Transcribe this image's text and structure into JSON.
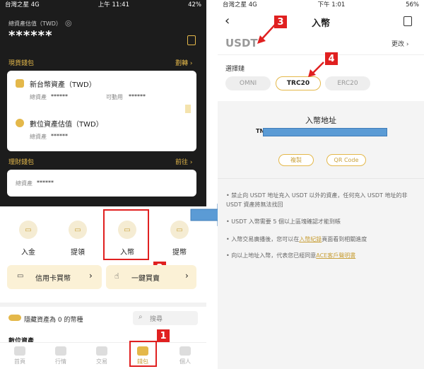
{
  "left": {
    "status": {
      "carrier": "台灣之星",
      "network": "4G",
      "time": "上午 11:41",
      "battery": "42%"
    },
    "total_label": "總資產估值（TWD）",
    "total_value": "******",
    "spot_wallet": {
      "title": "現貨錢包",
      "action": "劃轉"
    },
    "fiat_card": {
      "title": "新台幣資產（TWD）",
      "total_label": "總資產",
      "total_value": "******",
      "avail_label": "可動用",
      "avail_value": "******"
    },
    "crypto_card": {
      "title": "數位資產估值（TWD）",
      "total_label": "總資產",
      "total_value": "******"
    },
    "finance_wallet": {
      "title": "理財錢包",
      "action": "前往",
      "total_label": "總資產",
      "total_value": "******"
    },
    "actions": [
      "入金",
      "提領",
      "入幣",
      "提幣"
    ],
    "buy_card": "信用卡買幣",
    "buy_one": "一鍵買賣",
    "hide_zero": "隱藏資產為 0 的幣種",
    "search_placeholder": "搜尋",
    "digital_assets": "數位資產",
    "nav": [
      "首頁",
      "行情",
      "交易",
      "錢包",
      "個人"
    ],
    "tags": [
      "1",
      "2"
    ]
  },
  "right": {
    "status": {
      "carrier": "台灣之星",
      "network": "4G",
      "time": "下午 1:01",
      "battery": "56%"
    },
    "title": "入幣",
    "coin": "USDT",
    "change": "更改",
    "chain_label": "選擇鏈",
    "chains": [
      "OMNI",
      "TRC20",
      "ERC20"
    ],
    "address_title": "入幣地址",
    "address_prefix": "TN",
    "copy": "複製",
    "qr": "QR Code",
    "notices": [
      "• 禁止向 USDT 地址充入 USDT 以外的資產，任何充入 USDT 地址的非 USDT 資產將無法找回",
      "• USDT 入幣需要 5 個以上區塊確認才能到帳",
      "• 入幣交易廣播後，您可以在",
      "入幣紀錄",
      "頁面看到相關進度",
      "• 向以上地址入幣，代表您已經同意",
      "ACE客戶聲明書"
    ],
    "tags": [
      "3",
      "4"
    ]
  },
  "colors": {
    "gold": "#e4b84a",
    "dark": "#1c1c1c",
    "red": "#e02020",
    "blue": "#5b9bd5"
  }
}
